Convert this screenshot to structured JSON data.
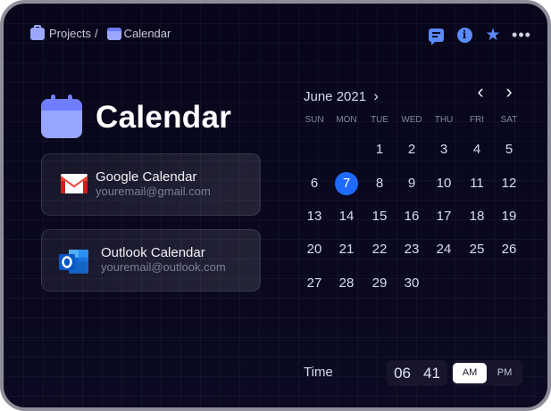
{
  "breadcrumb": {
    "projects": "Projects",
    "separator": "/",
    "current": "Calendar"
  },
  "header_icons": [
    "chat-icon",
    "info-icon",
    "star-icon",
    "more-icon"
  ],
  "page": {
    "title": "Calendar"
  },
  "accounts": [
    {
      "name": "Google Calendar",
      "email": "youremail@gmail.com",
      "icon": "gmail-icon"
    },
    {
      "name": "Outlook Calendar",
      "email": "youremail@outlook.com",
      "icon": "outlook-icon"
    }
  ],
  "calendar": {
    "month_label": "June 2021",
    "month_chevron": "›",
    "prev": "‹",
    "next": "›",
    "weekdays": [
      "SUN",
      "MON",
      "TUE",
      "WED",
      "THU",
      "FRI",
      "SAT"
    ],
    "days": [
      [
        "",
        "",
        "1",
        "2",
        "3",
        "4",
        "5"
      ],
      [
        "6",
        "7",
        "8",
        "9",
        "10",
        "11",
        "12"
      ],
      [
        "13",
        "14",
        "15",
        "16",
        "17",
        "18",
        "19"
      ],
      [
        "20",
        "21",
        "22",
        "23",
        "24",
        "25",
        "26"
      ],
      [
        "27",
        "28",
        "29",
        "30",
        "",
        "",
        ""
      ]
    ],
    "selected": "7"
  },
  "time": {
    "label": "Time",
    "hour": "06",
    "minute": "41",
    "am": "AM",
    "pm": "PM",
    "period": "AM"
  },
  "colors": {
    "accent": "#1f6bff",
    "icon_blue": "#5b8bff",
    "calendar_icon": "#98a5ff"
  }
}
